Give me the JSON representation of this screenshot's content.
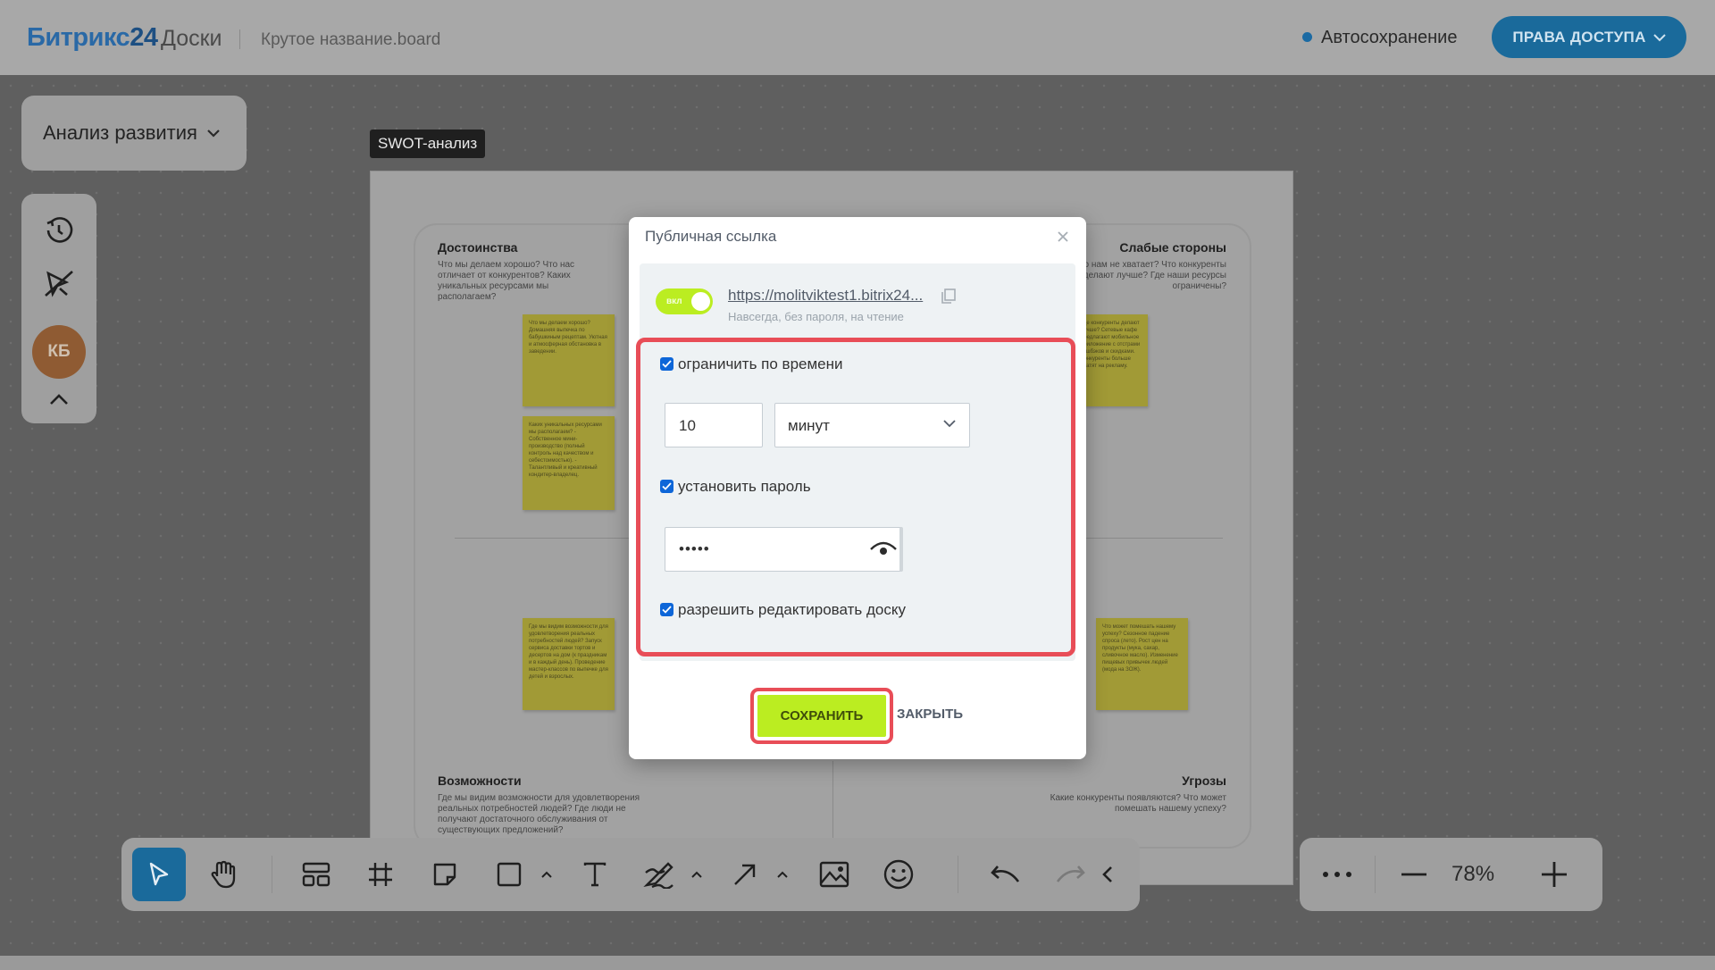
{
  "header": {
    "logo_main": "Битрикс",
    "logo_num": "24",
    "logo_sub": "Доски",
    "board_name": "Крутое название.board",
    "autosave": "Автосохранение",
    "access_button": "ПРАВА ДОСТУПА"
  },
  "left_panel": {
    "project_select": "Анализ развития",
    "avatar_initials": "КБ"
  },
  "board": {
    "frame_label": "SWOT-анализ",
    "quadrants": {
      "strengths": {
        "title": "Достоинства",
        "desc": "Что мы делаем хорошо? Что нас отличает от конкурентов? Каких уникальных ресурсами мы располагаем?"
      },
      "weaknesses": {
        "title": "Слабые стороны",
        "desc": "Чего нам не хватает? Что конкуренты делают лучше? Где наши ресурсы ограничены?"
      },
      "opportunities": {
        "title": "Возможности",
        "desc": "Где мы видим возможности для удовлетворения реальных потребностей людей? Где люди не получают достаточного обслуживания от существующих предложений?"
      },
      "threats": {
        "title": "Угрозы",
        "desc": "Какие конкуренты появляются? Что может помешать нашему успеху?"
      }
    },
    "stickies": [
      "Что мы делаем хорошо? Домашняя выпечка по бабушкиным рецептам. Уютная и атмосферная обстановка в заведении.",
      "Каких уникальных ресурсами мы располагаем? - Собственное мини-производство (полный контроль над качеством и себестоимостью). - Талантливый и креативный кондитер-владелец.",
      "Где мы видим возможности для удовлетворения реальных потребностей людей? Запуск сервиса доставки тортов и десертов на дом (к праздникам и в каждый день). Проведение мастер-классов по выпечке для детей и взрослых.",
      "Где конкуренты делают лучше? Сетевые кафе предлагают мобильное приложение с отстрами кэшбэков и скидками. Конкуренты больше тратят на рекламу.",
      "Что может помешать нашему успеху? Сезонное падение спроса (лето). Рост цен на продукты (мука, сахар, сливочное масло). Изменение пищевых привычек людей (мода на ЗОЖ)."
    ]
  },
  "toolbar": {
    "zoom": "78%"
  },
  "modal": {
    "title": "Публичная ссылка",
    "toggle_label": "вкл",
    "link": "https://molitviktest1.bitrix24...",
    "link_sub": "Навсегда, без пароля, на чтение",
    "limit_time_label": "ограничить по времени",
    "time_value": "10",
    "time_unit": "минут",
    "set_password_label": "установить пароль",
    "password_value": "•••••",
    "allow_edit_label": "разрешить редактировать доску",
    "save_button": "СОХРАНИТЬ",
    "close_button": "ЗАКРЫТЬ"
  },
  "colors": {
    "accent_blue": "#1a6a9b",
    "save_green": "#bbed21",
    "highlight_red": "#e84d57",
    "checkbox_blue": "#0d66d8"
  }
}
